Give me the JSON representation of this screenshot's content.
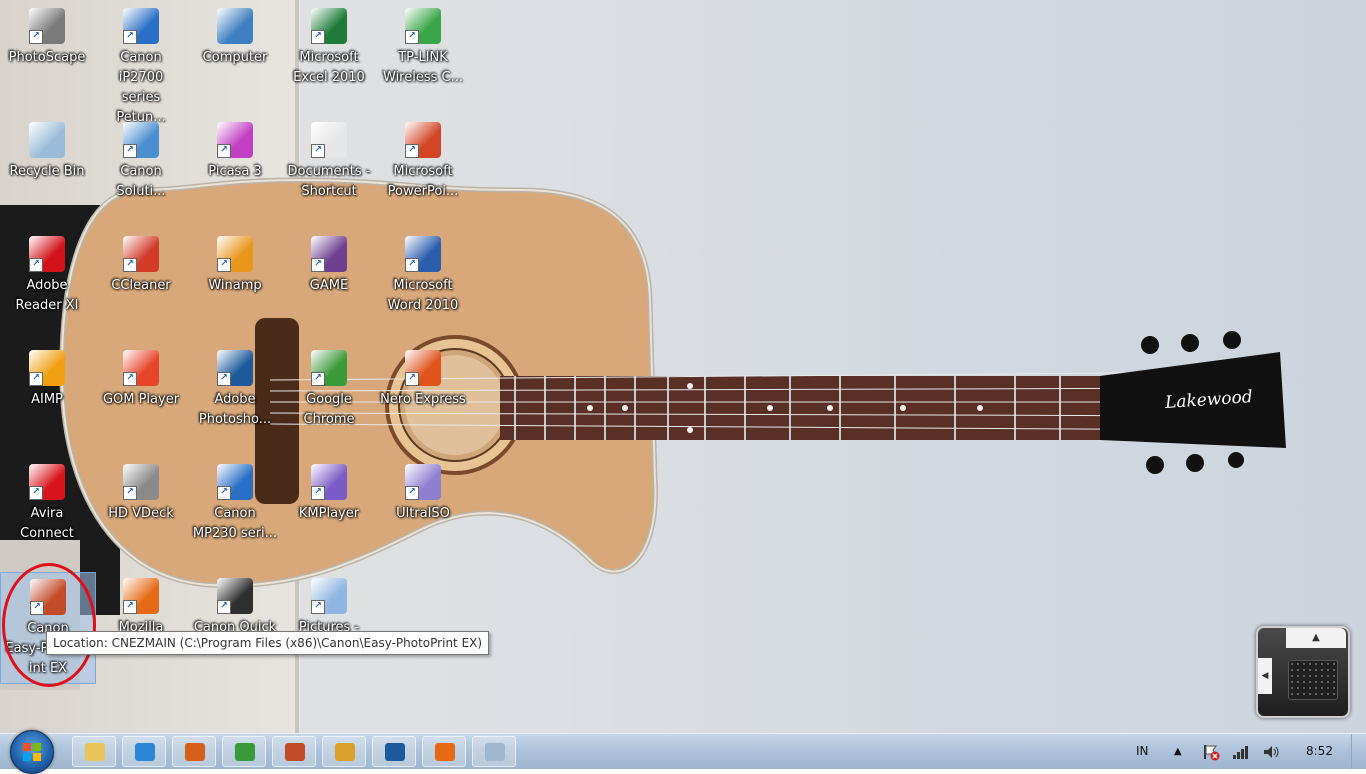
{
  "desktop": {
    "icons": [
      {
        "label": "PhotoScape",
        "icon": "photoscape-icon",
        "color": "#7a7a7a"
      },
      {
        "label": "Canon iP2700\nseries Petun...",
        "icon": "help-document-icon",
        "color": "#2a6fc6"
      },
      {
        "label": "Computer",
        "icon": "computer-icon",
        "color": "#3f7fbf"
      },
      {
        "label": "Microsoft\nExcel 2010",
        "icon": "excel-icon",
        "color": "#1e7b3a"
      },
      {
        "label": "TP-LINK\nWireless C...",
        "icon": "wifi-icon",
        "color": "#3aa64a"
      },
      {
        "label": "Recycle Bin",
        "icon": "recycle-bin-icon",
        "color": "#9bbcd8"
      },
      {
        "label": "Canon\nSoluti...",
        "icon": "canon-solution-icon",
        "color": "#4b8fd1"
      },
      {
        "label": "Picasa 3",
        "icon": "picasa-icon",
        "color": "#c23ec2"
      },
      {
        "label": "Documents -\nShortcut",
        "icon": "documents-icon",
        "color": "#e6e6e6"
      },
      {
        "label": "Microsoft\nPowerPoi...",
        "icon": "powerpoint-icon",
        "color": "#d24625"
      },
      {
        "label": "Adobe\nReader XI",
        "icon": "adobe-reader-icon",
        "color": "#d4121b"
      },
      {
        "label": "CCleaner",
        "icon": "ccleaner-icon",
        "color": "#d33a28"
      },
      {
        "label": "Winamp",
        "icon": "winamp-icon",
        "color": "#e8961c"
      },
      {
        "label": "GAME",
        "icon": "winrar-archive-icon",
        "color": "#6e3f8f"
      },
      {
        "label": "Microsoft\nWord 2010",
        "icon": "word-icon",
        "color": "#2b5dae"
      },
      {
        "label": "AIMP",
        "icon": "aimp-icon",
        "color": "#f0a010"
      },
      {
        "label": "GOM Player",
        "icon": "gom-player-icon",
        "color": "#e7452a"
      },
      {
        "label": "Adobe\nPhotosho...",
        "icon": "photoshop-icon",
        "color": "#1d5a9c"
      },
      {
        "label": "Google\nChrome",
        "icon": "chrome-icon",
        "color": "#3a9a3a"
      },
      {
        "label": "Nero Express",
        "icon": "nero-icon",
        "color": "#e0531c"
      },
      {
        "label": "Avira\nConnect",
        "icon": "avira-icon",
        "color": "#d8131b"
      },
      {
        "label": "HD VDeck",
        "icon": "hd-vdeck-icon",
        "color": "#8a8a8a"
      },
      {
        "label": "Canon\nMP230 seri...",
        "icon": "help-document-icon",
        "color": "#2a6fc6"
      },
      {
        "label": "KMPlayer",
        "icon": "kmplayer-icon",
        "color": "#7a5cc7"
      },
      {
        "label": "UltraISO",
        "icon": "ultraiso-icon",
        "color": "#8f7fd0"
      },
      {
        "label": "Canon\nEasy-PhotoPr\nint EX",
        "icon": "canon-easy-photoprint-icon",
        "color": "#c24b2a"
      },
      {
        "label": "Mozilla\nFirefox",
        "icon": "firefox-icon",
        "color": "#e66a16"
      },
      {
        "label": "Canon Quick\nMenu",
        "icon": "canon-quick-menu-icon",
        "color": "#2f2f2f"
      },
      {
        "label": "Pictures -\nShortcut",
        "icon": "pictures-icon",
        "color": "#8fb6e0"
      }
    ]
  },
  "tooltip": "Location: CNEZMAIN (C:\\Program Files (x86)\\Canon\\Easy-PhotoPrint EX)",
  "guitar": {
    "brand": "Lakewood"
  },
  "taskbar": {
    "start_icon": "windows-start-icon",
    "pinned": [
      {
        "name": "explorer-icon",
        "color": "#e8c55a"
      },
      {
        "name": "internet-explorer-icon",
        "color": "#2a86d6"
      },
      {
        "name": "user-app-icon",
        "color": "#d6601a"
      },
      {
        "name": "chrome-icon",
        "color": "#3a9a3a"
      },
      {
        "name": "easy-photoprint-icon",
        "color": "#c24b2a"
      },
      {
        "name": "media-player-icon",
        "color": "#d7a12a"
      },
      {
        "name": "photoshop-icon",
        "color": "#1d5a9c"
      },
      {
        "name": "firefox-icon",
        "color": "#e66a16"
      },
      {
        "name": "paint-icon",
        "color": "#9fb6cf"
      }
    ],
    "language": "IN",
    "clock": "8:52"
  }
}
